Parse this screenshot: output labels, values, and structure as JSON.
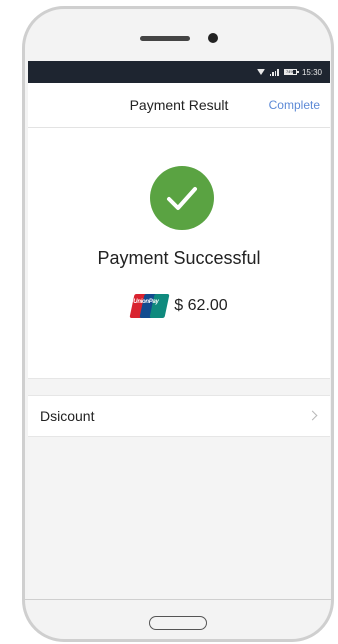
{
  "statusbar": {
    "battery": "74%",
    "time": "15:30",
    "battery_level": 0.74
  },
  "navbar": {
    "title": "Payment Result",
    "action": "Complete"
  },
  "result": {
    "message": "Payment Successful",
    "amount": "$ 62.00",
    "card_brand": "UnionPay",
    "check_color": "#5aa342"
  },
  "list": {
    "items": [
      {
        "label": "Dsicount"
      }
    ]
  },
  "colors": {
    "accent": "#5d8ad6",
    "statusbar_bg": "#1e2530",
    "success": "#5aa342"
  }
}
